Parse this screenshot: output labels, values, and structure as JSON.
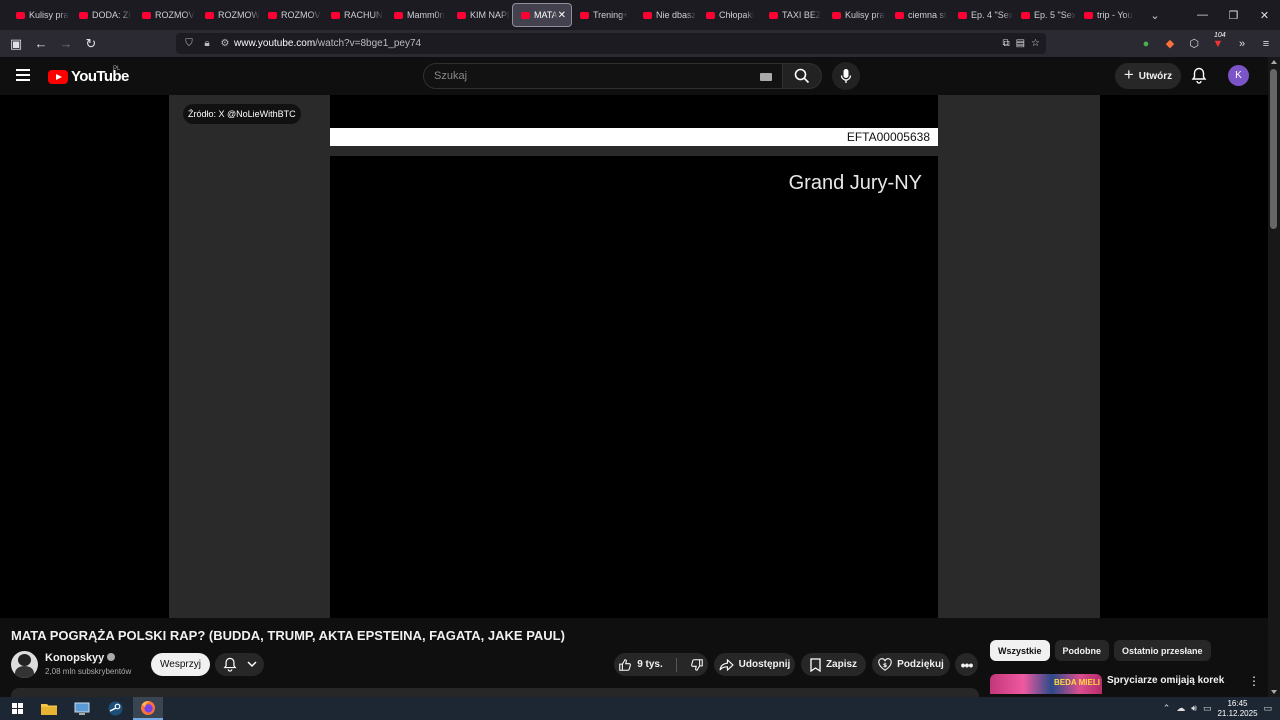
{
  "browser": {
    "tabs": [
      {
        "label": "Kulisy pra"
      },
      {
        "label": "DODA: Zł"
      },
      {
        "label": "ROZMOV"
      },
      {
        "label": "ROZMOW"
      },
      {
        "label": "ROZMOV"
      },
      {
        "label": "RACHUN"
      },
      {
        "label": "Mamm0n"
      },
      {
        "label": "KIM NAPI"
      },
      {
        "label": "MATA"
      },
      {
        "label": "Trening+"
      },
      {
        "label": "Nie dbasz"
      },
      {
        "label": "Chłopaki"
      },
      {
        "label": "TAXI BEZ"
      },
      {
        "label": "Kulisy pra"
      },
      {
        "label": "ciemna st"
      },
      {
        "label": "Ep. 4 \"Sex"
      },
      {
        "label": "Ep. 5 \"Sex"
      },
      {
        "label": "trip - You"
      }
    ],
    "active_tab_index": 8,
    "url_domain": "www.youtube.com",
    "url_path": "/watch?v=8bge1_pey74",
    "extensions_badge": "104"
  },
  "youtube": {
    "logo_text": "YouTube",
    "region": "PL",
    "search_placeholder": "Szukaj",
    "create_label": "Utwórz",
    "avatar_letter": "K",
    "accent_color": "#ff0000"
  },
  "video": {
    "source_overlay": "Źródło: X @NoLieWithBTC",
    "doc_stamp": "EFTA00005638",
    "doc_heading": "Grand Jury-NY",
    "title": "MATA POGRĄŻA POLSKI RAP? (BUDDA, TRUMP, AKTA EPSTEINA, FAGATA, JAKE PAUL)",
    "channel_name": "Konopskyy",
    "subscribers": "2,08 mln subskrybentów",
    "support_label": "Wesprzyj",
    "likes": "9 tys.",
    "share_label": "Udostępnij",
    "save_label": "Zapisz",
    "thanks_label": "Podziękuj"
  },
  "recommendations": {
    "chips": [
      "Wszystkie",
      "Podobne",
      "Ostatnio przesłane"
    ],
    "selected_chip": 0,
    "first_title": "Spryciarze omijają korek",
    "first_thumb_text": "BEDA MIELI"
  },
  "taskbar": {
    "time": "16:45",
    "date": "21.12.2025"
  }
}
